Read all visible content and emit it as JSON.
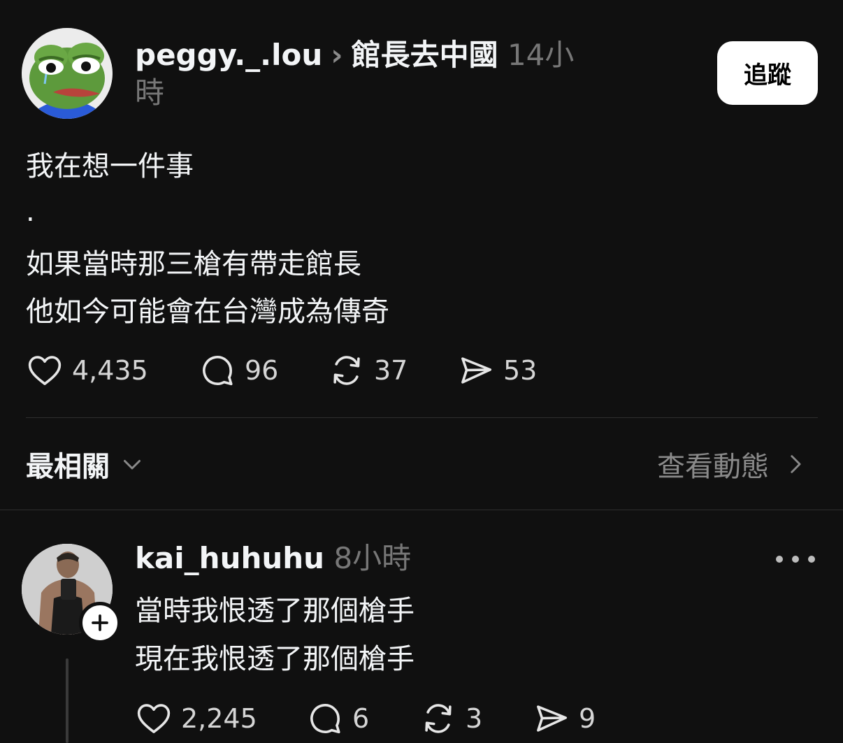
{
  "post": {
    "username": "peggy._.lou",
    "group": "館長去中國",
    "time": "14小時",
    "follow_label": "追蹤",
    "lines": [
      "我在想一件事",
      ".",
      "如果當時那三槍有帶走館長",
      "他如今可能會在台灣成為傳奇"
    ],
    "stats": {
      "likes": "4,435",
      "comments": "96",
      "reposts": "37",
      "shares": "53"
    }
  },
  "sort": {
    "label": "最相關",
    "activity_label": "查看動態"
  },
  "reply": {
    "username": "kai_huhuhu",
    "time": "8小時",
    "lines": [
      "當時我恨透了那個槍手",
      "現在我恨透了那個槍手"
    ],
    "stats": {
      "likes": "2,245",
      "comments": "6",
      "reposts": "3",
      "shares": "9"
    }
  },
  "icons": {
    "like": "heart-icon",
    "comment": "comment-bubble-icon",
    "repost": "repost-icon",
    "share": "send-icon",
    "chevron": "chevron-right-icon",
    "dropdown": "chevron-down-icon",
    "more": "more-dots-icon",
    "plus": "plus-icon"
  },
  "colors": {
    "background": "#101010",
    "text": "#f3f5f7",
    "muted": "#777777",
    "button": "#ffffff"
  }
}
